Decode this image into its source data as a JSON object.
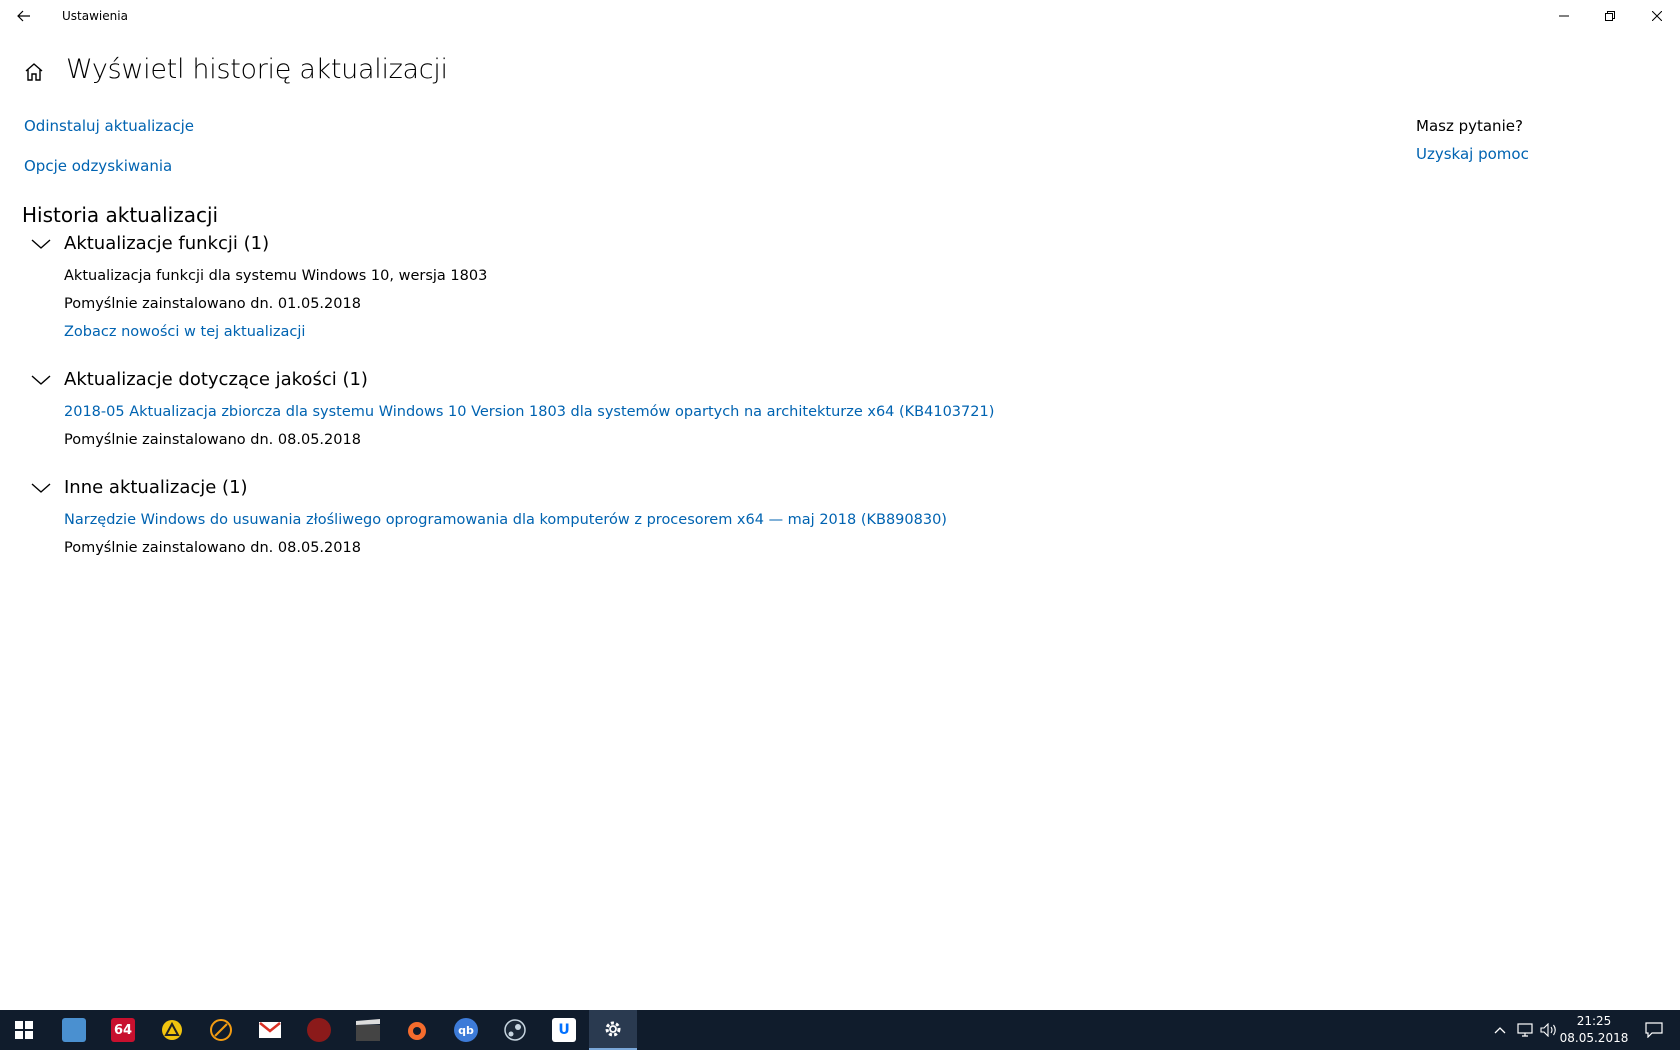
{
  "window": {
    "title": "Ustawienia"
  },
  "page": {
    "title": "Wyświetl historię aktualizacji"
  },
  "links": {
    "uninstall": "Odinstaluj aktualizacje",
    "recovery": "Opcje odzyskiwania"
  },
  "aside": {
    "question": "Masz pytanie?",
    "help": "Uzyskaj pomoc"
  },
  "history": {
    "title": "Historia aktualizacji",
    "groups": [
      {
        "title": "Aktualizacje funkcji (1)",
        "entries": [
          {
            "name": "Aktualizacja funkcji dla systemu Windows 10, wersja 1803",
            "status": "Pomyślnie zainstalowano dn. 01.05.2018",
            "link": "Zobacz nowości w tej aktualizacji"
          }
        ]
      },
      {
        "title": "Aktualizacje dotyczące jakości (1)",
        "entries": [
          {
            "name": "2018-05 Aktualizacja zbiorcza dla systemu Windows 10 Version 1803 dla systemów opartych na architekturze x64 (KB4103721)",
            "status": "Pomyślnie zainstalowano dn. 08.05.2018"
          }
        ]
      },
      {
        "title": "Inne aktualizacje (1)",
        "entries": [
          {
            "name": "Narzędzie Windows do usuwania złośliwego oprogramowania dla komputerów z procesorem x64 — maj 2018 (KB890830)",
            "status": "Pomyślnie zainstalowano dn. 08.05.2018"
          }
        ]
      }
    ]
  },
  "taskbar": {
    "apps": [
      {
        "name": "start-icon"
      },
      {
        "name": "explorer-icon"
      },
      {
        "name": "aida64-icon",
        "label": "64"
      },
      {
        "name": "occt-icon"
      },
      {
        "name": "pen-app-icon"
      },
      {
        "name": "gmail-icon"
      },
      {
        "name": "cpu-z-icon"
      },
      {
        "name": "mpc-hc-icon"
      },
      {
        "name": "origin-icon"
      },
      {
        "name": "qbittorrent-icon",
        "label": "qb"
      },
      {
        "name": "steam-icon"
      },
      {
        "name": "uplay-icon"
      },
      {
        "name": "settings-icon"
      }
    ],
    "clock": {
      "time": "21:25",
      "date": "08.05.2018"
    }
  },
  "colors": {
    "link": "#0063b1",
    "taskbar": "#101c2c"
  }
}
